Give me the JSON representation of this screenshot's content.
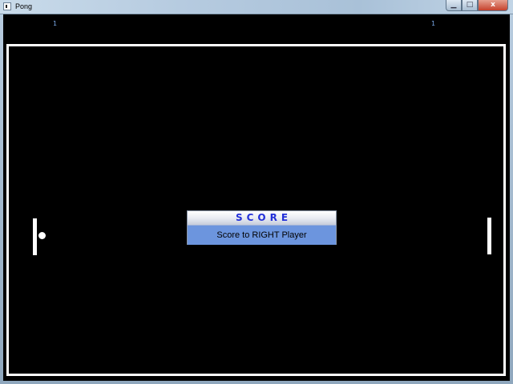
{
  "window": {
    "title": "Pong",
    "buttons": {
      "minimize_glyph": "▁",
      "maximize_glyph": "□",
      "close_glyph": "x"
    },
    "icon": "app-icon"
  },
  "scores": {
    "left": "1",
    "right": "1"
  },
  "dialog": {
    "title": "SCORE",
    "message": "Score to RIGHT Player"
  },
  "colors": {
    "court_background": "#000000",
    "court_border": "#ffffff",
    "score_text": "#7aa9e8",
    "dialog_title_text": "#2330d8",
    "dialog_body_background": "#6c95de"
  }
}
